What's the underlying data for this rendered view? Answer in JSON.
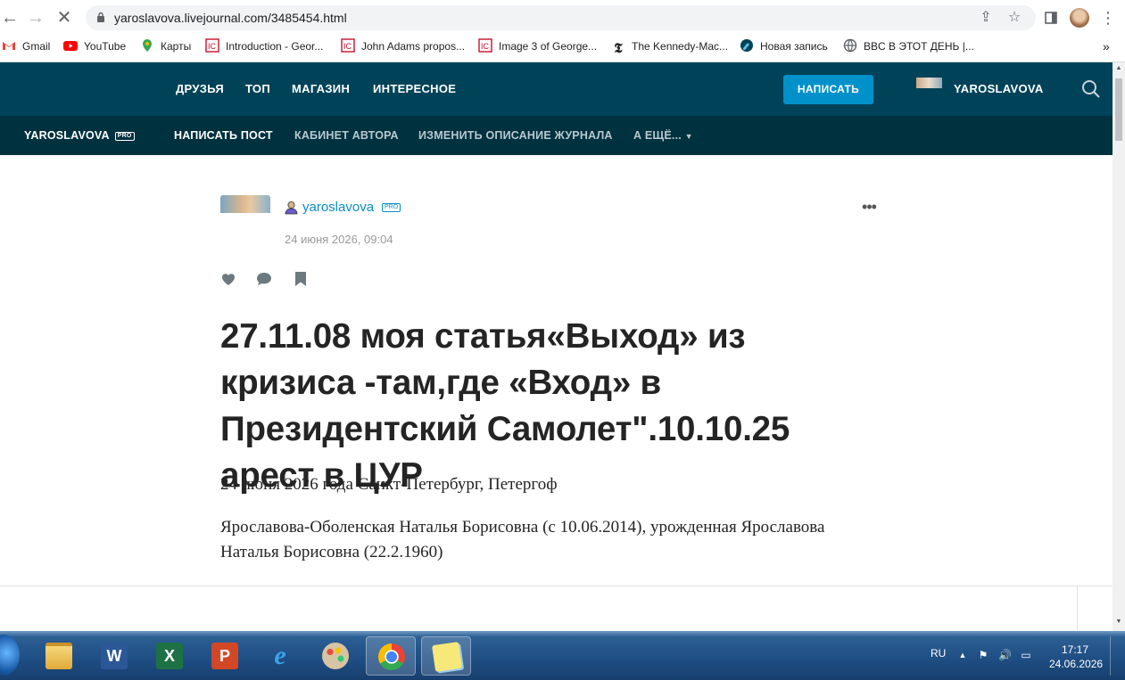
{
  "browser": {
    "url": "yaroslavova.livejournal.com/3485454.html",
    "bookmarks": [
      {
        "label": "Gmail",
        "icon": "gmail-icon"
      },
      {
        "label": "YouTube",
        "icon": "youtube-icon"
      },
      {
        "label": "Карты",
        "icon": "maps-icon"
      },
      {
        "label": "Introduction - Geor...",
        "icon": "archive-icon"
      },
      {
        "label": "John Adams propos...",
        "icon": "archive-icon"
      },
      {
        "label": "Image 3 of George...",
        "icon": "archive-icon"
      },
      {
        "label": "The Kennedy-Mac...",
        "icon": "nyt-icon"
      },
      {
        "label": "Новая запись",
        "icon": "livejournal-icon"
      },
      {
        "label": "BBC В ЭТОТ ДЕНЬ |...",
        "icon": "globe-icon"
      }
    ],
    "more_bookmarks": "»"
  },
  "site_nav": {
    "links": [
      "ДРУЗЬЯ",
      "ТОП",
      "МАГАЗИН",
      "ИНТЕРЕСНОЕ"
    ],
    "write_button": "НАПИСАТЬ",
    "user": "YAROSLAVOVA"
  },
  "journal_bar": {
    "journal_name": "YAROSLAVOVA",
    "pro": "PRO",
    "links": [
      "НАПИСАТЬ ПОСТ",
      "КАБИНЕТ АВТОРА",
      "ИЗМЕНИТЬ ОПИСАНИЕ ЖУРНАЛА",
      "А ЕЩЁ..."
    ]
  },
  "post": {
    "author": "yaroslavova",
    "pro": "PRO",
    "date": "24 июня 2026, 09:04",
    "title": "27.11.08 моя статья«Выход» из кризиса -там,где «Вход» в Президентский Самолет\".10.10.25 арест в ЦУР",
    "paragraphs": [
      "24 июня 2026 года Санкт-Петербург, Петергоф",
      "Ярославова-Оболенская Наталья Борисовна (с 10.06.2014), урожденная Ярославова Наталья Борисовна (22.2.1960)"
    ]
  },
  "taskbar": {
    "language": "RU",
    "time": "17:17",
    "date": "24.06.2026"
  },
  "colors": {
    "site_nav_bg": "#004359",
    "journal_bar_bg": "#00313f",
    "accent_button": "#0091ca",
    "link": "#0b8fc4",
    "title_text": "#242424"
  }
}
